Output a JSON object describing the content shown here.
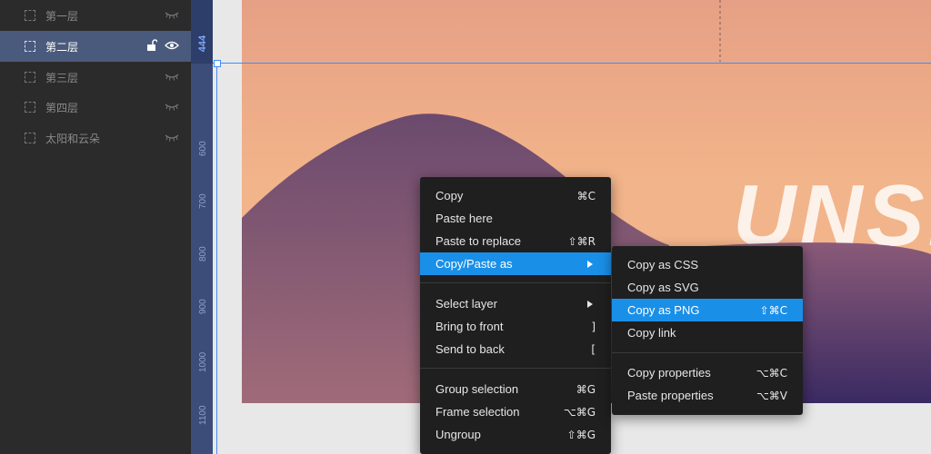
{
  "layers": [
    {
      "name": "第一层",
      "active": false
    },
    {
      "name": "第二层",
      "active": true
    },
    {
      "name": "第三层",
      "active": false
    },
    {
      "name": "第四层",
      "active": false
    },
    {
      "name": "太阳和云朵",
      "active": false
    }
  ],
  "ruler": {
    "highlight": "444",
    "labels": [
      "600",
      "700",
      "800",
      "900",
      "1000",
      "1100"
    ]
  },
  "artboard_text": "UNSET",
  "context_menu": {
    "items": [
      {
        "label": "Copy",
        "shortcut": "⌘C"
      },
      {
        "label": "Paste here",
        "shortcut": ""
      },
      {
        "label": "Paste to replace",
        "shortcut": "⇧⌘R"
      },
      {
        "label": "Copy/Paste as",
        "shortcut": ""
      },
      {
        "label": "Select layer",
        "shortcut": ""
      },
      {
        "label": "Bring to front",
        "shortcut": "]"
      },
      {
        "label": "Send to back",
        "shortcut": "["
      },
      {
        "label": "Group selection",
        "shortcut": "⌘G"
      },
      {
        "label": "Frame selection",
        "shortcut": "⌥⌘G"
      },
      {
        "label": "Ungroup",
        "shortcut": "⇧⌘G"
      }
    ]
  },
  "submenu": {
    "items": [
      {
        "label": "Copy as CSS",
        "shortcut": ""
      },
      {
        "label": "Copy as SVG",
        "shortcut": ""
      },
      {
        "label": "Copy as PNG",
        "shortcut": "⇧⌘C"
      },
      {
        "label": "Copy link",
        "shortcut": ""
      },
      {
        "label": "Copy properties",
        "shortcut": "⌥⌘C"
      },
      {
        "label": "Paste properties",
        "shortcut": "⌥⌘V"
      }
    ]
  },
  "colors": {
    "panel_bg": "#2b2b2b",
    "active_layer": "#4a5a7c",
    "menu_bg": "#1f1f1f",
    "menu_highlight": "#1a8fe8",
    "guide": "#3f8ef5"
  }
}
